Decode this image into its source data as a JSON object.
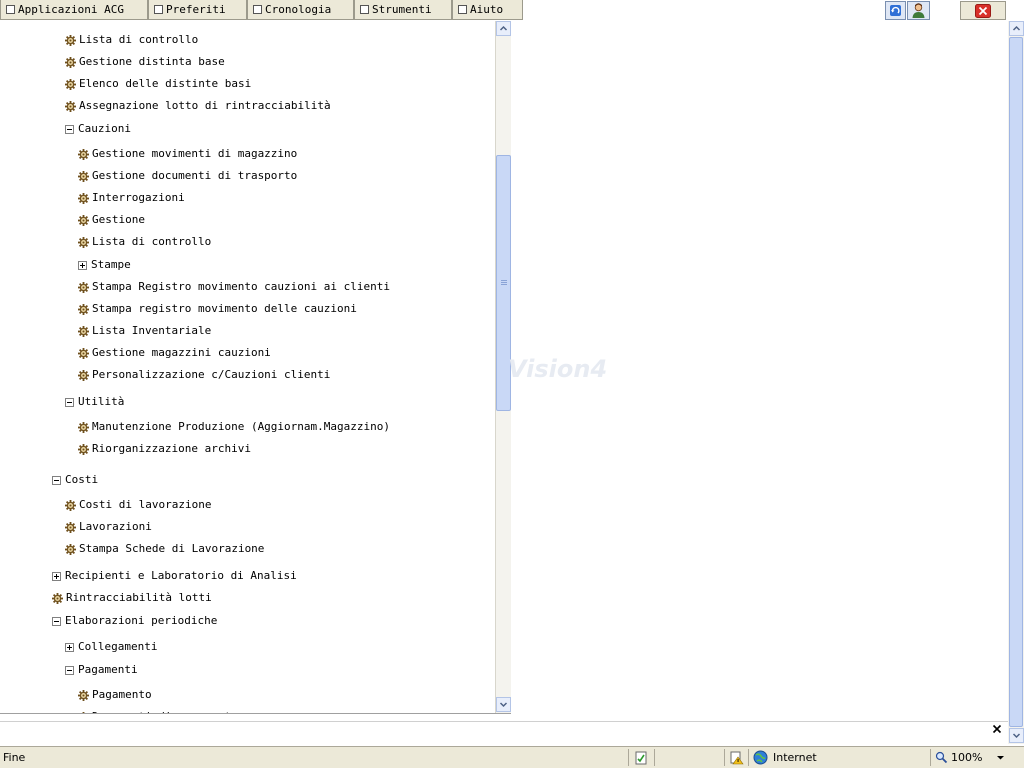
{
  "menu": {
    "tabs": [
      "Applicazioni ACG",
      "Preferiti",
      "Cronologia",
      "Strumenti",
      "Aiuto"
    ]
  },
  "tree": {
    "items": [
      {
        "label": "Lista di controllo",
        "type": "leaf"
      },
      {
        "label": "Gestione distinta base",
        "type": "leaf"
      },
      {
        "label": "Elenco delle distinte basi",
        "type": "leaf"
      },
      {
        "label": "Assegnazione lotto di rintracciabilità",
        "type": "leaf"
      },
      {
        "label": "Cauzioni",
        "type": "expanded"
      },
      {
        "label": "Gestione movimenti di magazzino",
        "type": "leaf"
      },
      {
        "label": "Gestione documenti di trasporto",
        "type": "leaf"
      },
      {
        "label": "Interrogazioni",
        "type": "leaf"
      },
      {
        "label": "Gestione",
        "type": "leaf"
      },
      {
        "label": "Lista di controllo",
        "type": "leaf"
      },
      {
        "label": "Stampe",
        "type": "collapsed"
      },
      {
        "label": "Stampa Registro movimento cauzioni ai clienti",
        "type": "leaf"
      },
      {
        "label": "Stampa registro movimento delle cauzioni",
        "type": "leaf"
      },
      {
        "label": "Lista Inventariale",
        "type": "leaf"
      },
      {
        "label": "Gestione magazzini cauzioni",
        "type": "leaf"
      },
      {
        "label": "Personalizzazione c/Cauzioni clienti",
        "type": "leaf"
      },
      {
        "label": "Utilità",
        "type": "expanded"
      },
      {
        "label": "Manutenzione Produzione (Aggiornam.Magazzino)",
        "type": "leaf"
      },
      {
        "label": "Riorganizzazione archivi",
        "type": "leaf"
      },
      {
        "label": "Costi",
        "type": "expanded"
      },
      {
        "label": "Costi di lavorazione",
        "type": "leaf"
      },
      {
        "label": "Lavorazioni",
        "type": "leaf"
      },
      {
        "label": "Stampa Schede di Lavorazione",
        "type": "leaf"
      },
      {
        "label": "Recipienti e Laboratorio di Analisi",
        "type": "collapsed"
      },
      {
        "label": "Rintracciabilità lotti",
        "type": "leaf"
      },
      {
        "label": "Elaborazioni periodiche",
        "type": "expanded"
      },
      {
        "label": "Collegamenti",
        "type": "collapsed"
      },
      {
        "label": "Pagamenti",
        "type": "expanded"
      },
      {
        "label": "Pagamento",
        "type": "leaf"
      },
      {
        "label": "Documenti di pagamento",
        "type": "leaf"
      }
    ]
  },
  "watermark": "Vision4",
  "status": {
    "text": "Fine",
    "zone": "Internet",
    "zoom": "100%"
  },
  "icons": {
    "gear": "gear-icon",
    "refresh": "refresh-icon",
    "user": "user-icon",
    "close": "close-icon"
  },
  "colors": {
    "chrome": "#ece9d8",
    "scroll_thumb": "#c9d8f6",
    "close_red": "#d8302a"
  }
}
